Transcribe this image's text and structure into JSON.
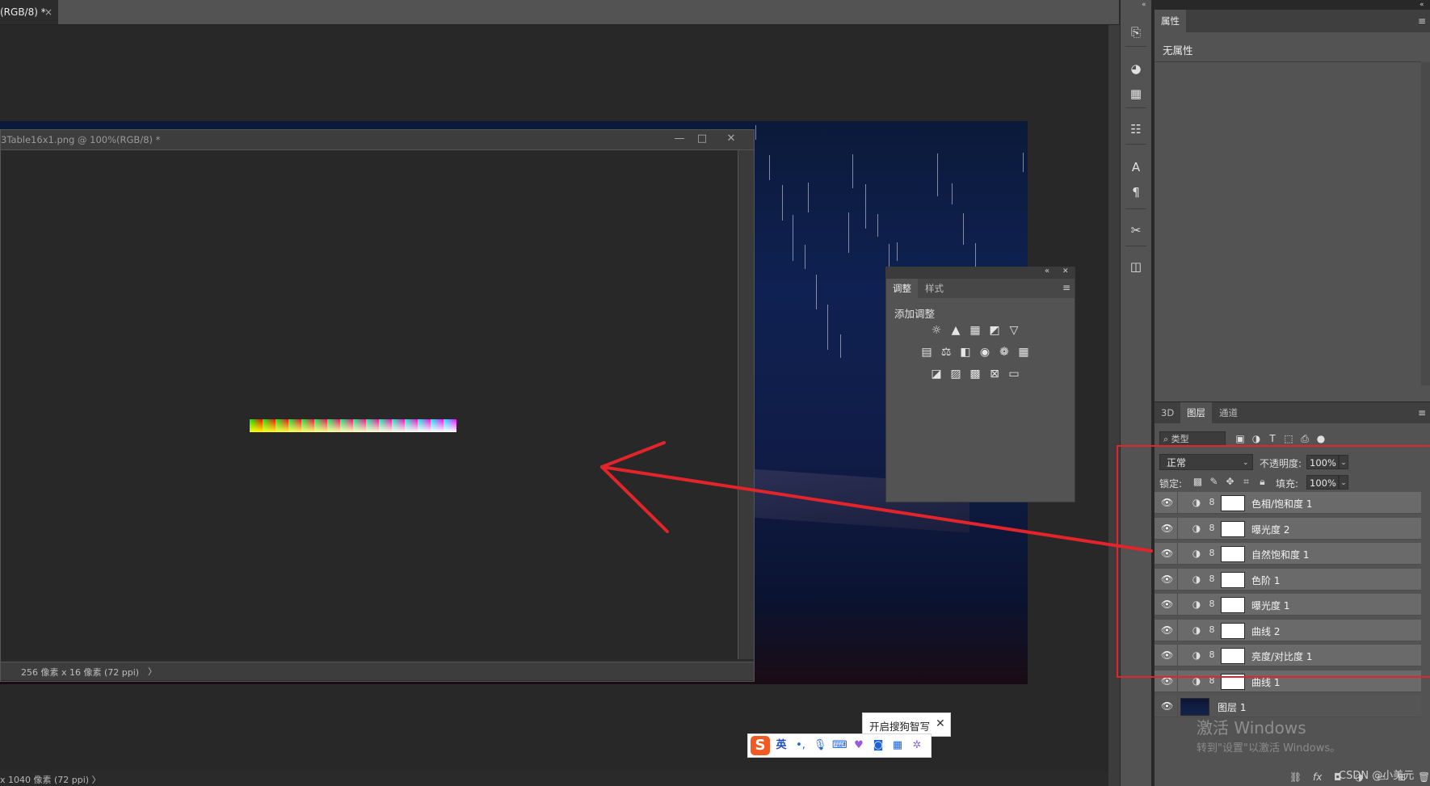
{
  "document_tab": {
    "label": "(RGB/8) *",
    "close": "×"
  },
  "floating_window": {
    "title": "3Table16x1.png @ 100%(RGB/8) *",
    "status": "256 像素 x 16 像素 (72 ppi)",
    "status_arrow": "〉",
    "buttons": {
      "minimize": "—",
      "maximize": "□",
      "close": "✕"
    }
  },
  "bottom_status": "x 1040 像素 (72 ppi)     〉",
  "adjustments_panel": {
    "tabs": [
      "调整",
      "样式"
    ],
    "title": "添加调整",
    "header_buttons": {
      "collapse": "«",
      "close": "✕"
    },
    "menu": "≡"
  },
  "properties_panel": {
    "tab": "属性",
    "empty_text": "无属性",
    "menu": "≡",
    "collapse": "«"
  },
  "layers_panel": {
    "tabs": [
      "3D",
      "图层",
      "通道"
    ],
    "menu": "≡",
    "filter_label": "类型",
    "blend_mode": "正常",
    "opacity_label": "不透明度:",
    "opacity_value": "100%",
    "lock_label": "锁定:",
    "fill_label": "填充:",
    "fill_value": "100%",
    "layers": [
      {
        "name": "色相/饱和度 1",
        "type": "adjustment",
        "visible": true
      },
      {
        "name": "曝光度 2",
        "type": "adjustment",
        "visible": true
      },
      {
        "name": "自然饱和度 1",
        "type": "adjustment",
        "visible": true
      },
      {
        "name": "色阶 1",
        "type": "adjustment",
        "visible": true
      },
      {
        "name": "曝光度 1",
        "type": "adjustment",
        "visible": true
      },
      {
        "name": "曲线 2",
        "type": "adjustment",
        "visible": true
      },
      {
        "name": "亮度/对比度 1",
        "type": "adjustment",
        "visible": true
      },
      {
        "name": "曲线 1",
        "type": "adjustment",
        "visible": true
      },
      {
        "name": "图层 1",
        "type": "pixel",
        "visible": true
      }
    ]
  },
  "watermark": {
    "title": "激活 Windows",
    "subtitle": "转到\"设置\"以激活 Windows。",
    "csdn": "CSDN @小美元"
  },
  "ime": {
    "logo": "S",
    "lang": "英",
    "punct": "•,",
    "tip": "开启搜狗智写",
    "tip_close": "✕"
  },
  "colors": {
    "annotation_red": "#e3242b",
    "panel_bg": "#535353",
    "workspace_bg": "#282828"
  }
}
